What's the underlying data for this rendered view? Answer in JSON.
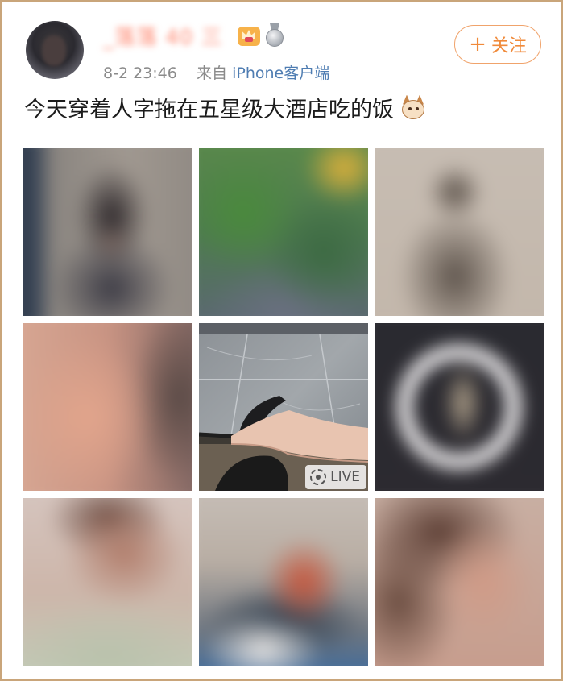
{
  "post": {
    "username": "_落落 40 三",
    "timestamp": "8-2 23:46",
    "source_prefix": "来自",
    "source": "iPhone客户端",
    "follow_label": "关注",
    "follow_plus": "+",
    "text": "今天穿着人字拖在五星级大酒店吃的饭",
    "emoji_icon": "cat-face-icon",
    "badges": [
      "crown-vip-icon",
      "silver-medal-icon"
    ]
  },
  "photos": [
    {
      "name": "photo-1",
      "subject": "mirror-selfie"
    },
    {
      "name": "photo-2",
      "subject": "plants"
    },
    {
      "name": "photo-3",
      "subject": "cat"
    },
    {
      "name": "photo-4",
      "subject": "face"
    },
    {
      "name": "photo-5",
      "subject": "feet-in-slippers",
      "badge": "LIVE"
    },
    {
      "name": "photo-6",
      "subject": "ring-light"
    },
    {
      "name": "photo-7",
      "subject": "face"
    },
    {
      "name": "photo-8",
      "subject": "drink"
    },
    {
      "name": "photo-9",
      "subject": "face"
    }
  ],
  "colors": {
    "border": "#c9a57a",
    "follow_accent": "#f08a3a",
    "link": "#4f7db2",
    "username": "#ff8a73"
  }
}
